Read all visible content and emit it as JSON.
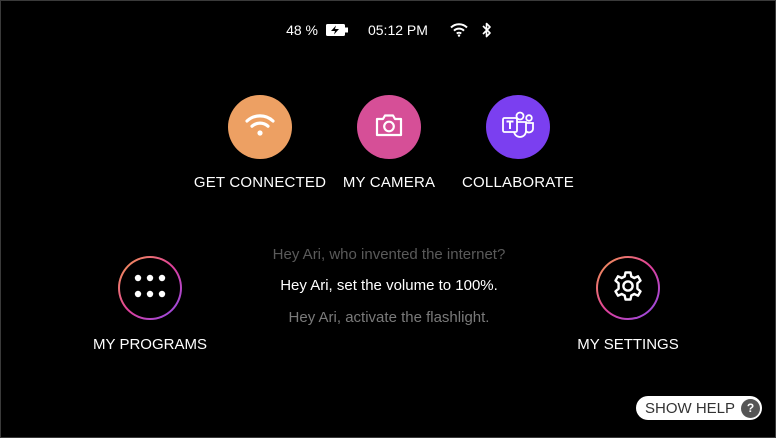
{
  "status_bar": {
    "battery_text": "48 %",
    "time": "05:12 PM",
    "icons": [
      "battery-charging-icon",
      "wifi-icon",
      "bluetooth-icon"
    ]
  },
  "tiles": [
    {
      "label": "GET CONNECTED",
      "icon": "wifi-icon",
      "color": "#eda063"
    },
    {
      "label": "MY CAMERA",
      "icon": "camera-icon",
      "color": "#d64f97"
    },
    {
      "label": "COLLABORATE",
      "icon": "teams-icon",
      "color": "#7b3ff0"
    }
  ],
  "ring_tiles": [
    {
      "label": "MY PROGRAMS",
      "icon": "apps-grid-icon"
    },
    {
      "label": "MY SETTINGS",
      "icon": "gear-icon"
    }
  ],
  "suggestions": [
    "Hey Ari, who invented the internet?",
    "Hey Ari, set the volume to 100%.",
    "Hey Ari, activate the flashlight."
  ],
  "help": {
    "label": "SHOW HELP",
    "icon_text": "?"
  },
  "colors": {
    "background": "#000000",
    "ring_gradient": [
      "#f6a04d",
      "#e0409a",
      "#8a4cf0"
    ]
  }
}
